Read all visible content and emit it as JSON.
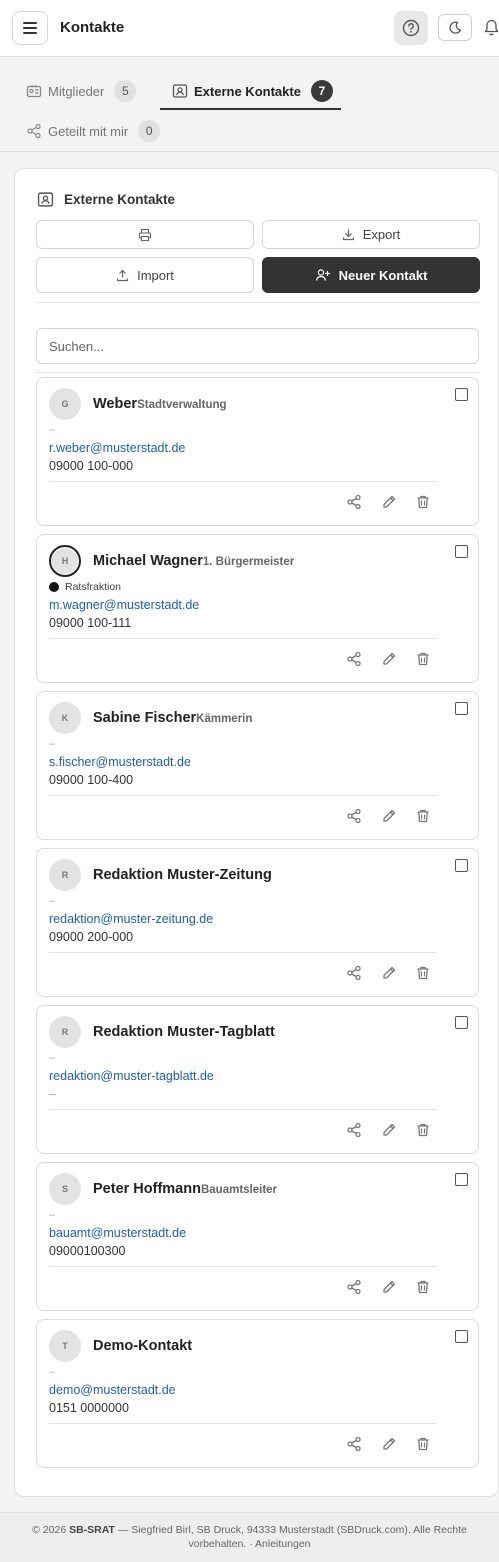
{
  "header": {
    "title": "Kontakte",
    "icons": [
      "menu-icon",
      "help-icon",
      "moon-icon",
      "bell-icon"
    ]
  },
  "tabs": [
    {
      "label": "Mitglieder",
      "count": "5",
      "icon": "members-icon",
      "active": false
    },
    {
      "label": "Externe Kontakte",
      "count": "7",
      "icon": "contact-card-icon",
      "active": true
    },
    {
      "label": "Geteilt mit mir",
      "count": "0",
      "icon": "share-icon",
      "active": false
    }
  ],
  "panel": {
    "title": "Externe Kontakte",
    "print_icon": "printer-icon",
    "export_label": "Export",
    "import_label": "Import",
    "new_label": "Neuer Kontakt",
    "search_placeholder": "Suchen..."
  },
  "contacts": [
    {
      "initial": "G",
      "name": "Weber",
      "role": "Stadtverwaltung",
      "org": "–",
      "fraktion": "",
      "email": "r.weber@musterstadt.de",
      "phone": "09000 100-000"
    },
    {
      "initial": "H",
      "name": "Michael Wagner",
      "role": "1. Bürgermeister",
      "org": "",
      "fraktion": "Ratsfraktion",
      "email": "m.wagner@musterstadt.de",
      "phone": "09000 100-111"
    },
    {
      "initial": "K",
      "name": "Sabine Fischer",
      "role": "Kämmerin",
      "org": "–",
      "fraktion": "",
      "email": "s.fischer@musterstadt.de",
      "phone": "09000 100-400"
    },
    {
      "initial": "R",
      "name": "Redaktion Muster-Zeitung",
      "role": "",
      "org": "–",
      "fraktion": "",
      "email": "redaktion@muster-zeitung.de",
      "phone": "09000 200-000"
    },
    {
      "initial": "R",
      "name": "Redaktion Muster-Tagblatt",
      "role": "",
      "org": "–",
      "fraktion": "",
      "email": "redaktion@muster-tagblatt.de",
      "phone": "–"
    },
    {
      "initial": "S",
      "name": "Peter Hoffmann",
      "role": "Bauamtsleiter",
      "org": "–",
      "fraktion": "",
      "email": "bauamt@musterstadt.de",
      "phone": "09000100300"
    },
    {
      "initial": "T",
      "name": "Demo-Kontakt",
      "role": "",
      "org": "–",
      "fraktion": "",
      "email": "demo@musterstadt.de",
      "phone": "0151 0000000"
    }
  ],
  "footer": {
    "copy": "© 2026",
    "brand": "SB-SRAT",
    "text": "— Siegfried Birl, SB Druck, 94333 Musterstadt (SBDruck.com). Alle Rechte vorbehalten.",
    "sep": "·",
    "link": "Anleitungen"
  },
  "colors": {
    "accent_dark": "#333333",
    "link": "#1f5fae"
  }
}
